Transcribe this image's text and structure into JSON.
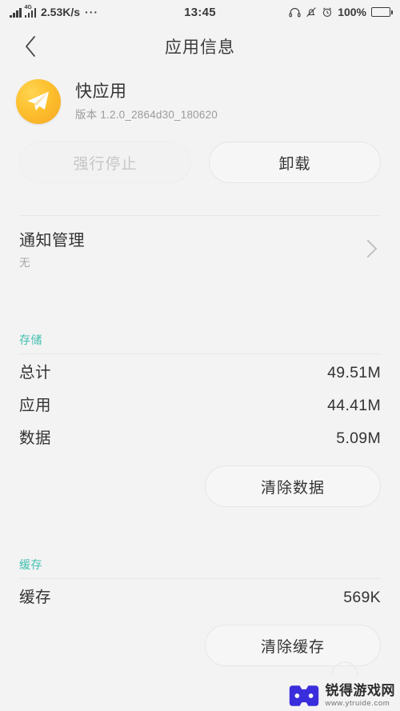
{
  "statusbar": {
    "signal_icon": "signal-bars-icon",
    "network_label": "4G",
    "network_speed": "2.53K/s",
    "overflow_dots": "···",
    "time": "13:45",
    "headphone_icon": "headphone-icon",
    "mute_icon": "bell-muted-icon",
    "alarm_icon": "alarm-clock-icon",
    "battery_percent": "100%",
    "battery_icon": "battery-full-icon"
  },
  "titlebar": {
    "back_icon": "back-chevron-icon",
    "title": "应用信息"
  },
  "app": {
    "icon": "paper-plane-icon",
    "name": "快应用",
    "version": "版本 1.2.0_2864d30_180620"
  },
  "actions": {
    "force_stop_label": "强行停止",
    "force_stop_disabled": true,
    "uninstall_label": "卸载"
  },
  "notification": {
    "title": "通知管理",
    "subtitle": "无",
    "chevron_icon": "chevron-right-icon"
  },
  "storage": {
    "header": "存储",
    "rows": [
      {
        "key": "总计",
        "value": "49.51M"
      },
      {
        "key": "应用",
        "value": "44.41M"
      },
      {
        "key": "数据",
        "value": "5.09M"
      }
    ],
    "clear_button": "清除数据"
  },
  "cache": {
    "header": "缓存",
    "rows": [
      {
        "key": "缓存",
        "value": "569K"
      }
    ],
    "clear_button": "清除缓存"
  },
  "watermark": {
    "title": "锐得游戏网",
    "url": "www.ytruide.com",
    "logo_icon": "gamepad-logo-icon"
  },
  "colors": {
    "background": "#f3f3f3",
    "section_accent": "#41bfb0",
    "text_primary": "#333333",
    "text_secondary": "#9b9b9b",
    "disabled_text": "#c6c6c6",
    "app_icon_gradient": "#f5a623"
  }
}
